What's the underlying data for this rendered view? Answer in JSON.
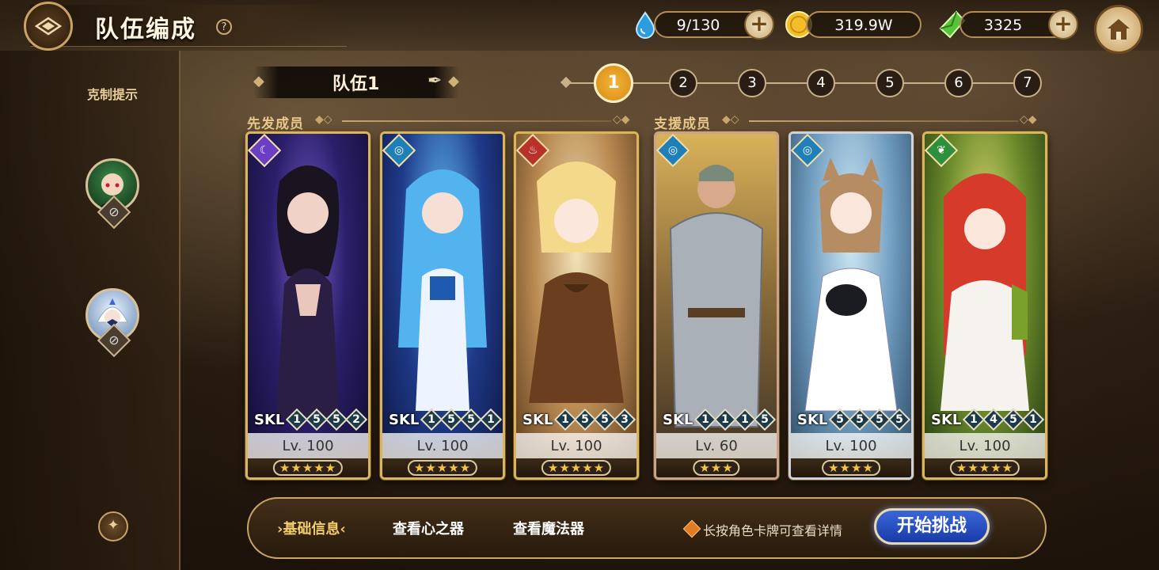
{
  "header": {
    "title": "队伍编成",
    "help_glyph": "?",
    "resources": [
      {
        "name": "water-drop",
        "value": "9/130",
        "plus": "+"
      },
      {
        "name": "gold-coin",
        "value": "319.9W",
        "plus": "+"
      },
      {
        "name": "green-crystal",
        "value": "3325",
        "plus": "+"
      }
    ]
  },
  "left": {
    "counter_hint": "克制提示",
    "badge_glyph": "⊘"
  },
  "team": {
    "name": "队伍1",
    "tabs": [
      "1",
      "2",
      "3",
      "4",
      "5",
      "6",
      "7"
    ],
    "active_tab": "1"
  },
  "sections": {
    "starters": "先发成员",
    "support": "支援成员"
  },
  "cards": [
    {
      "attr": "dark",
      "attr_color": "#6a3fc4",
      "skl_label": "SKL",
      "skills": [
        "1",
        "5",
        "5",
        "2"
      ],
      "level": "Lv. 100",
      "stars": "★★★★★"
    },
    {
      "attr": "water",
      "attr_color": "#1f7fb8",
      "skl_label": "SKL",
      "skills": [
        "1",
        "5",
        "5",
        "1"
      ],
      "level": "Lv. 100",
      "stars": "★★★★★"
    },
    {
      "attr": "fire",
      "attr_color": "#b8322a",
      "skl_label": "SKL",
      "skills": [
        "1",
        "5",
        "5",
        "3"
      ],
      "level": "Lv. 100",
      "stars": "★★★★★"
    },
    {
      "attr": "water",
      "attr_color": "#1f7fb8",
      "skl_label": "SKL",
      "skills": [
        "1",
        "1",
        "1",
        "5"
      ],
      "level": "Lv. 60",
      "stars": "★★★"
    },
    {
      "attr": "water",
      "attr_color": "#1f7fb8",
      "skl_label": "SKL",
      "skills": [
        "5",
        "5",
        "5",
        "5"
      ],
      "level": "Lv. 100",
      "stars": "★★★★"
    },
    {
      "attr": "wind",
      "attr_color": "#2e8f3c",
      "skl_label": "SKL",
      "skills": [
        "1",
        "4",
        "5",
        "1"
      ],
      "level": "Lv. 100",
      "stars": "★★★★★"
    }
  ],
  "bottom": {
    "tab_basic": "基础信息",
    "tab_heart": "查看心之器",
    "tab_magic": "查看魔法器",
    "hint": "长按角色卡牌可查看详情",
    "start": "开始挑战"
  }
}
